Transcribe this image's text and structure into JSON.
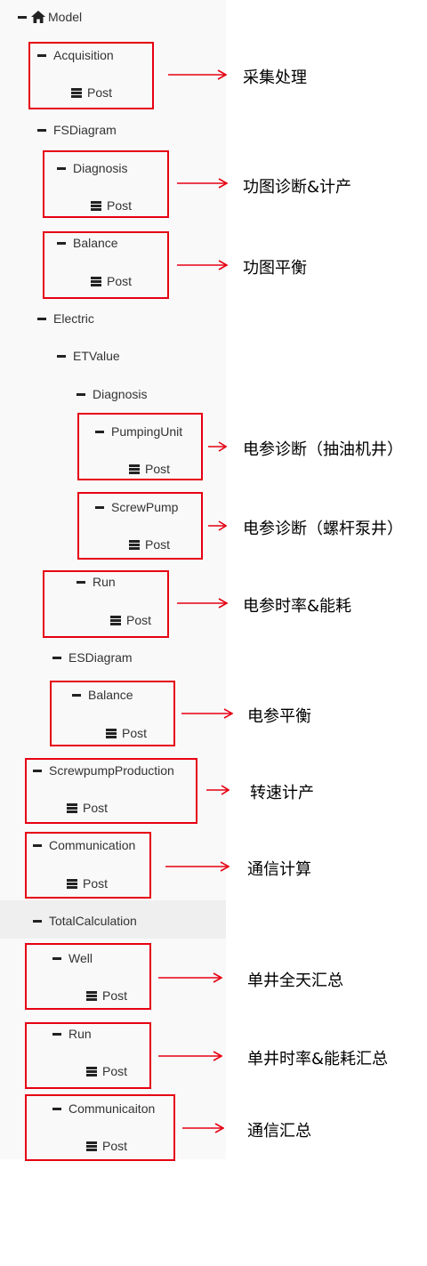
{
  "tree": {
    "root": "Model",
    "post_label": "Post",
    "nodes": {
      "acquisition": "Acquisition",
      "fsdiagram": "FSDiagram",
      "fs_diagnosis": "Diagnosis",
      "fs_balance": "Balance",
      "electric": "Electric",
      "etvalue": "ETValue",
      "et_diagnosis": "Diagnosis",
      "pumpingunit": "PumpingUnit",
      "screwpump": "ScrewPump",
      "et_run": "Run",
      "esdiagram": "ESDiagram",
      "es_balance": "Balance",
      "screwpumpproduction": "ScrewpumpProduction",
      "communication": "Communication",
      "totalcalculation": "TotalCalculation",
      "well": "Well",
      "total_run": "Run",
      "communicaiton": "Communicaiton"
    }
  },
  "annotations": [
    "采集处理",
    "功图诊断&计产",
    "功图平衡",
    "电参诊断（抽油机井）",
    "电参诊断（螺杆泵井）",
    "电参时率&能耗",
    "电参平衡",
    "转速计产",
    "通信计算",
    "单井全天汇总",
    "单井时率&能耗汇总",
    "通信汇总"
  ],
  "colors": {
    "annotation_red": "#e60012",
    "panel_bg": "#f9f9f9",
    "highlight_bg": "#efefef"
  },
  "icons": {
    "root": "home-icon",
    "collapse": "minus-icon",
    "method": "list-icon"
  }
}
